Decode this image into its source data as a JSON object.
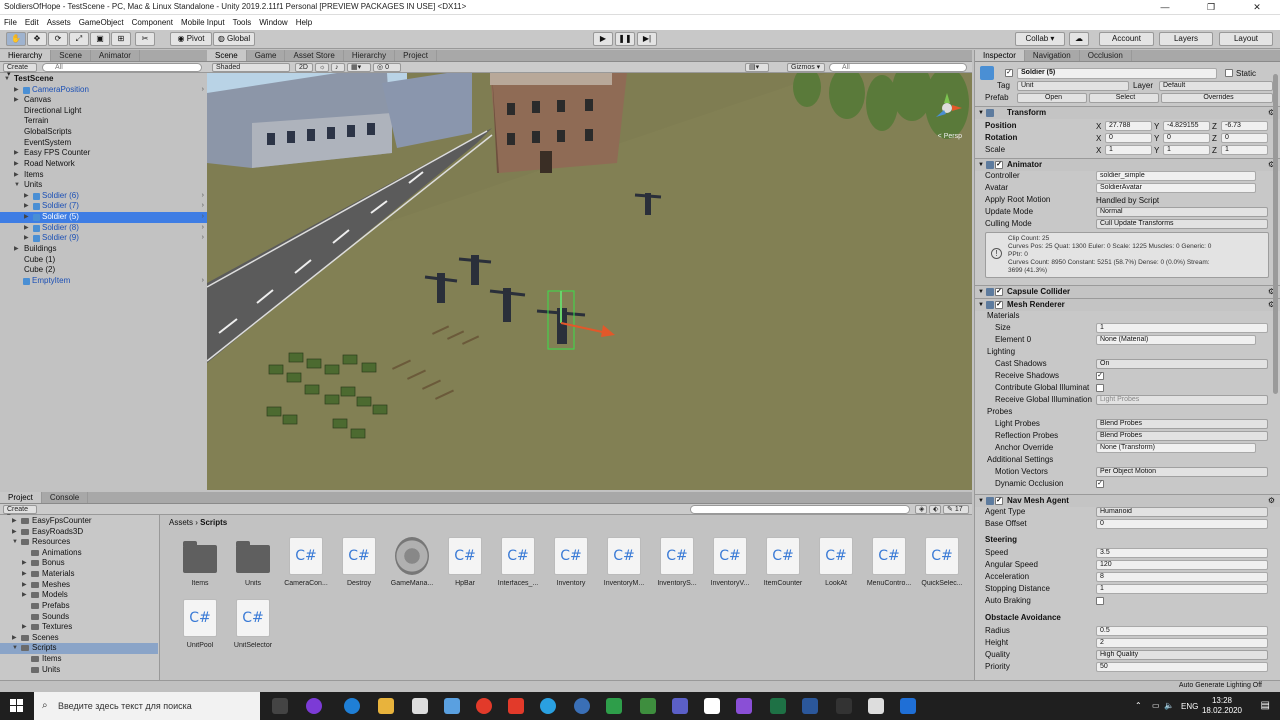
{
  "window": {
    "title": "SoldiersOfHope - TestScene - PC, Mac & Linux Standalone - Unity 2019.2.11f1 Personal [PREVIEW PACKAGES IN USE] <DX11>",
    "buttons": [
      "—",
      "❐",
      "✕"
    ]
  },
  "menu": [
    "File",
    "Edit",
    "Assets",
    "GameObject",
    "Component",
    "Mobile Input",
    "Tools",
    "Window",
    "Help"
  ],
  "toolbar": {
    "pivot": "Pivot",
    "global": "Global",
    "collab": "Collab ▾",
    "account": "Account",
    "layers": "Layers",
    "layout": "Layout",
    "cloud": "☁"
  },
  "hierarchy": {
    "tabs": [
      "Hierarchy",
      "Scene",
      "Animator"
    ],
    "create": "Create ▾",
    "search": "All",
    "rows": [
      {
        "label": "TestScene",
        "indent": 0,
        "arrow": "▼",
        "bold": true
      },
      {
        "label": "CameraPosition",
        "indent": 1,
        "arrow": "▶",
        "blue": true,
        "rarrow": true
      },
      {
        "label": "Canvas",
        "indent": 1,
        "arrow": "▶"
      },
      {
        "label": "Directional Light",
        "indent": 1,
        "arrow": ""
      },
      {
        "label": "Terrain",
        "indent": 1,
        "arrow": ""
      },
      {
        "label": "GlobalScripts",
        "indent": 1,
        "arrow": ""
      },
      {
        "label": "EventSystem",
        "indent": 1,
        "arrow": ""
      },
      {
        "label": "Easy FPS Counter",
        "indent": 1,
        "arrow": "▶"
      },
      {
        "label": "Road Network",
        "indent": 1,
        "arrow": "▶"
      },
      {
        "label": "Items",
        "indent": 1,
        "arrow": "▶"
      },
      {
        "label": "Units",
        "indent": 1,
        "arrow": "▼"
      },
      {
        "label": "Soldier (6)",
        "indent": 2,
        "arrow": "▶",
        "blue": true,
        "rarrow": true
      },
      {
        "label": "Soldier (7)",
        "indent": 2,
        "arrow": "▶",
        "blue": true,
        "rarrow": true
      },
      {
        "label": "Soldier (5)",
        "indent": 2,
        "arrow": "▶",
        "blue": true,
        "rarrow": true,
        "selected": true
      },
      {
        "label": "Soldier (8)",
        "indent": 2,
        "arrow": "▶",
        "blue": true,
        "rarrow": true
      },
      {
        "label": "Soldier (9)",
        "indent": 2,
        "arrow": "▶",
        "blue": true,
        "rarrow": true
      },
      {
        "label": "Buildings",
        "indent": 1,
        "arrow": "▶"
      },
      {
        "label": "Cube (1)",
        "indent": 1,
        "arrow": ""
      },
      {
        "label": "Cube (2)",
        "indent": 1,
        "arrow": ""
      },
      {
        "label": "EmptyItem",
        "indent": 1,
        "arrow": "",
        "blue": true,
        "rarrow": true
      }
    ]
  },
  "scene": {
    "tabs": [
      "Scene",
      "Game",
      "Asset Store",
      "Hierarchy",
      "Project"
    ],
    "shading": "Shaded",
    "mode2d": "2D",
    "gizmos": "Gizmos ▾",
    "search": "All",
    "hidden_count": "0",
    "persp": "< Persp"
  },
  "project": {
    "tabs": [
      "Project",
      "Console"
    ],
    "create": "Create ▾",
    "breadcrumb": [
      "Assets",
      "Scripts"
    ],
    "count": "17",
    "tree": [
      {
        "label": "EasyFpsCounter",
        "indent": 1,
        "arrow": "▶"
      },
      {
        "label": "EasyRoads3D",
        "indent": 1,
        "arrow": "▶"
      },
      {
        "label": "Resources",
        "indent": 1,
        "arrow": "▼"
      },
      {
        "label": "Animations",
        "indent": 2,
        "arrow": ""
      },
      {
        "label": "Bonus",
        "indent": 2,
        "arrow": "▶"
      },
      {
        "label": "Materials",
        "indent": 2,
        "arrow": "▶"
      },
      {
        "label": "Meshes",
        "indent": 2,
        "arrow": "▶"
      },
      {
        "label": "Models",
        "indent": 2,
        "arrow": "▶"
      },
      {
        "label": "Prefabs",
        "indent": 2,
        "arrow": ""
      },
      {
        "label": "Sounds",
        "indent": 2,
        "arrow": ""
      },
      {
        "label": "Textures",
        "indent": 2,
        "arrow": "▶"
      },
      {
        "label": "Scenes",
        "indent": 1,
        "arrow": "▶"
      },
      {
        "label": "Scripts",
        "indent": 1,
        "arrow": "▼",
        "selected": true
      },
      {
        "label": "Items",
        "indent": 2,
        "arrow": ""
      },
      {
        "label": "Units",
        "indent": 2,
        "arrow": ""
      }
    ],
    "assets": [
      {
        "name": "Items",
        "kind": "folder"
      },
      {
        "name": "Units",
        "kind": "folder"
      },
      {
        "name": "CameraCon...",
        "kind": "cs"
      },
      {
        "name": "Destroy",
        "kind": "cs"
      },
      {
        "name": "GameMana...",
        "kind": "gear"
      },
      {
        "name": "HpBar",
        "kind": "cs"
      },
      {
        "name": "Interfaces_...",
        "kind": "cs"
      },
      {
        "name": "Inventory",
        "kind": "cs"
      },
      {
        "name": "InventoryM...",
        "kind": "cs"
      },
      {
        "name": "InventoryS...",
        "kind": "cs"
      },
      {
        "name": "InventoryV...",
        "kind": "cs"
      },
      {
        "name": "ItemCounter",
        "kind": "cs"
      },
      {
        "name": "LookAt",
        "kind": "cs"
      },
      {
        "name": "MenuContro...",
        "kind": "cs"
      },
      {
        "name": "QuickSelec...",
        "kind": "cs"
      },
      {
        "name": "UnitPool",
        "kind": "cs"
      },
      {
        "name": "UnitSelector",
        "kind": "cs"
      }
    ],
    "cs_glyph": "C#"
  },
  "inspector": {
    "tabs": [
      "Inspector",
      "Navigation",
      "Occlusion"
    ],
    "object_name": "Soldier (5)",
    "static_label": "Static",
    "tag_label": "Tag",
    "tag": "Unit",
    "layer_label": "Layer",
    "layer": "Default",
    "prefab_label": "Prefab",
    "prefab_open": "Open",
    "prefab_select": "Select",
    "prefab_overrides": "Overrides",
    "transform": {
      "title": "Transform",
      "position_label": "Position",
      "rotation_label": "Rotation",
      "scale_label": "Scale",
      "position": [
        "27.788",
        "-4.829155",
        "-6.73"
      ],
      "rotation": [
        "0",
        "0",
        "0"
      ],
      "scale": [
        "1",
        "1",
        "1"
      ],
      "axes": [
        "X",
        "Y",
        "Z"
      ]
    },
    "animator": {
      "title": "Animator",
      "controller_label": "Controller",
      "controller": "soldier_simple",
      "avatar_label": "Avatar",
      "avatar": "SoldierAvatar",
      "root_motion_label": "Apply Root Motion",
      "root_motion": "Handled by Script",
      "update_mode_label": "Update Mode",
      "update_mode": "Normal",
      "culling_label": "Culling Mode",
      "culling": "Cull Update Transforms",
      "info": [
        "Clip Count: 25",
        "Curves Pos: 25 Quat: 1300 Euler: 0 Scale: 1225 Muscles: 0 Generic: 0",
        "PPtr: 0",
        "Curves Count: 8950 Constant: 5251 (58.7%) Dense: 0 (0.0%) Stream:",
        "3699 (41.3%)"
      ]
    },
    "capsule": {
      "title": "Capsule Collider"
    },
    "mesh_renderer": {
      "title": "Mesh Renderer",
      "materials_label": "Materials",
      "size_label": "Size",
      "size": "1",
      "element0_label": "Element 0",
      "element0": "None (Material)",
      "lighting_label": "Lighting",
      "cast_label": "Cast Shadows",
      "cast": "On",
      "receive_label": "Receive Shadows",
      "contribute_label": "Contribute Global Illuminat",
      "receive_gi_label": "Receive Global Illumination",
      "receive_gi": "Light Probes",
      "probes_label": "Probes",
      "light_probes_label": "Light Probes",
      "light_probes": "Blend Probes",
      "refl_label": "Reflection Probes",
      "refl": "Blend Probes",
      "anchor_label": "Anchor Override",
      "anchor": "None (Transform)",
      "additional_label": "Additional Settings",
      "motion_label": "Motion Vectors",
      "motion": "Per Object Motion",
      "dyn_label": "Dynamic Occlusion"
    },
    "nav_agent": {
      "title": "Nav Mesh Agent",
      "agent_type_label": "Agent Type",
      "agent_type": "Humanoid",
      "base_offset_label": "Base Offset",
      "base_offset": "0",
      "steering": "Steering",
      "speed_label": "Speed",
      "speed": "3.5",
      "angular_label": "Angular Speed",
      "angular": "120",
      "accel_label": "Acceleration",
      "accel": "8",
      "stop_label": "Stopping Distance",
      "stop": "1",
      "braking_label": "Auto Braking",
      "avoidance": "Obstacle Avoidance",
      "radius_label": "Radius",
      "radius": "0.5",
      "height_label": "Height",
      "height": "2",
      "quality_label": "Quality",
      "quality": "High Quality",
      "priority_label": "Priority",
      "priority": "50"
    }
  },
  "status": {
    "right": "Auto Generate Lighting Off"
  },
  "taskbar": {
    "search": "Введите здесь текст для поиска",
    "lang": "ENG",
    "time": "13:28",
    "date": "18.02.2020"
  },
  "colors": {
    "selection": "#3e7de4",
    "prefab_blue": "#1a4fb5",
    "grass": "#7f7d52",
    "road": "#5b5b5b",
    "sky": "#b9d3e6"
  }
}
